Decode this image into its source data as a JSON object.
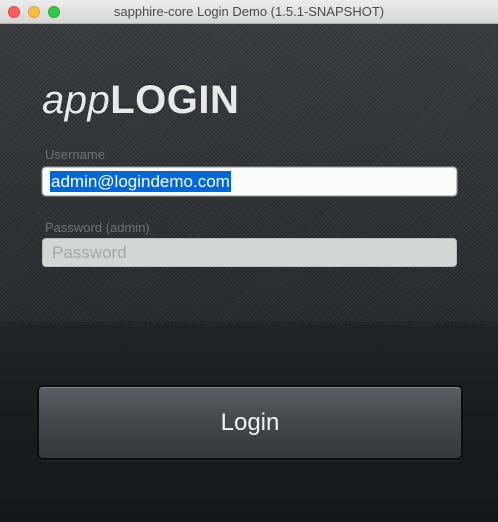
{
  "window": {
    "title": "sapphire-core Login Demo (1.5.1-SNAPSHOT)",
    "controls": [
      "close",
      "minimize",
      "zoom"
    ]
  },
  "logo": {
    "part1": "app",
    "part2": "LOGIN"
  },
  "username": {
    "label": "Username",
    "value": "admin@logindemo.com"
  },
  "password": {
    "label": "Password (admin)",
    "placeholder": "Password"
  },
  "login_button": {
    "label": "Login"
  },
  "colors": {
    "background": "#2b2d31",
    "selection": "#0069d9",
    "label_text": "#6f7176"
  }
}
